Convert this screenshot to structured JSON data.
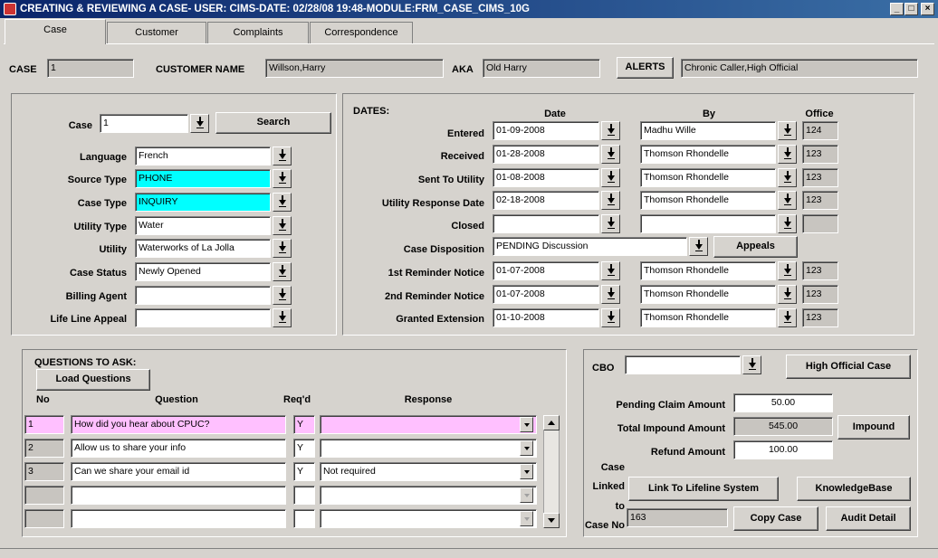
{
  "window": {
    "title": "CREATING & REVIEWING A CASE- USER: CIMS-DATE: 02/28/08 19:48-MODULE:FRM_CASE_CIMS_10G"
  },
  "tabs": [
    "Case",
    "Customer",
    "Complaints",
    "Correspondence"
  ],
  "header": {
    "case_label": "CASE",
    "case_value": "1",
    "customer_label": "CUSTOMER NAME",
    "customer_value": "Willson,Harry",
    "aka_label": "AKA",
    "aka_value": "Old Harry",
    "alerts_label": "ALERTS",
    "alerts_value": "Chronic Caller,High Official"
  },
  "case_info": {
    "case_label": "Case",
    "case_value": "1",
    "search_label": "Search",
    "language_label": "Language",
    "language_value": "French",
    "source_type_label": "Source Type",
    "source_type_value": "PHONE",
    "case_type_label": "Case Type",
    "case_type_value": "INQUIRY",
    "utility_type_label": "Utility Type",
    "utility_type_value": "Water",
    "utility_label": "Utility",
    "utility_value": "Waterworks of La Jolla",
    "case_status_label": "Case Status",
    "case_status_value": "Newly Opened",
    "billing_agent_label": "Billing Agent",
    "billing_agent_value": "",
    "life_line_label": "Life Line Appeal",
    "life_line_value": ""
  },
  "dates": {
    "section_label": "DATES:",
    "col_date": "Date",
    "col_by": "By",
    "col_office": "Office",
    "entered": {
      "label": "Entered",
      "date": "01-09-2008",
      "by": "Madhu Wille",
      "office": "124"
    },
    "received": {
      "label": "Received",
      "date": "01-28-2008",
      "by": "Thomson Rhondelle",
      "office": "123"
    },
    "sent": {
      "label": "Sent To Utility",
      "date": "01-08-2008",
      "by": "Thomson Rhondelle",
      "office": "123"
    },
    "response": {
      "label": "Utility Response Date",
      "date": "02-18-2008",
      "by": "Thomson Rhondelle",
      "office": "123"
    },
    "closed": {
      "label": "Closed",
      "date": "",
      "by": "",
      "office": ""
    },
    "disposition_label": "Case Disposition",
    "disposition_value": "PENDING Discussion",
    "appeals_label": "Appeals",
    "reminder1": {
      "label": "1st Reminder Notice",
      "date": "01-07-2008",
      "by": "Thomson Rhondelle",
      "office": "123"
    },
    "reminder2": {
      "label": "2nd Reminder Notice",
      "date": "01-07-2008",
      "by": "Thomson Rhondelle",
      "office": "123"
    },
    "extension": {
      "label": "Granted Extension",
      "date": "01-10-2008",
      "by": "Thomson Rhondelle",
      "office": "123"
    }
  },
  "questions": {
    "section_label": "QUESTIONS TO ASK:",
    "load_label": "Load Questions",
    "col_no": "No",
    "col_question": "Question",
    "col_reqd": "Req'd",
    "col_response": "Response",
    "rows": [
      {
        "no": "1",
        "question": "How did you hear about CPUC?",
        "reqd": "Y",
        "response": ""
      },
      {
        "no": "2",
        "question": "Allow us to share your info",
        "reqd": "Y",
        "response": ""
      },
      {
        "no": "3",
        "question": "Can we share your email id",
        "reqd": "Y",
        "response": "Not required"
      },
      {
        "no": "",
        "question": "",
        "reqd": "",
        "response": ""
      },
      {
        "no": "",
        "question": "",
        "reqd": "",
        "response": ""
      }
    ]
  },
  "right_panel": {
    "cbo_label": "CBO",
    "cbo_value": "",
    "high_official_label": "High Official Case",
    "pending_label": "Pending Claim Amount",
    "pending_value": "50.00",
    "impound_total_label": "Total Impound Amount",
    "impound_total_value": "545.00",
    "impound_label": "Impound",
    "refund_label": "Refund Amount",
    "refund_value": "100.00",
    "linked_line1": "Case",
    "linked_line2": "Linked",
    "linked_line3": "to",
    "linked_line4": "Case No",
    "linked_value": "163",
    "lifeline_label": "Link To Lifeline System",
    "kb_label": "KnowledgeBase",
    "copy_label": "Copy Case",
    "audit_label": "Audit Detail"
  }
}
